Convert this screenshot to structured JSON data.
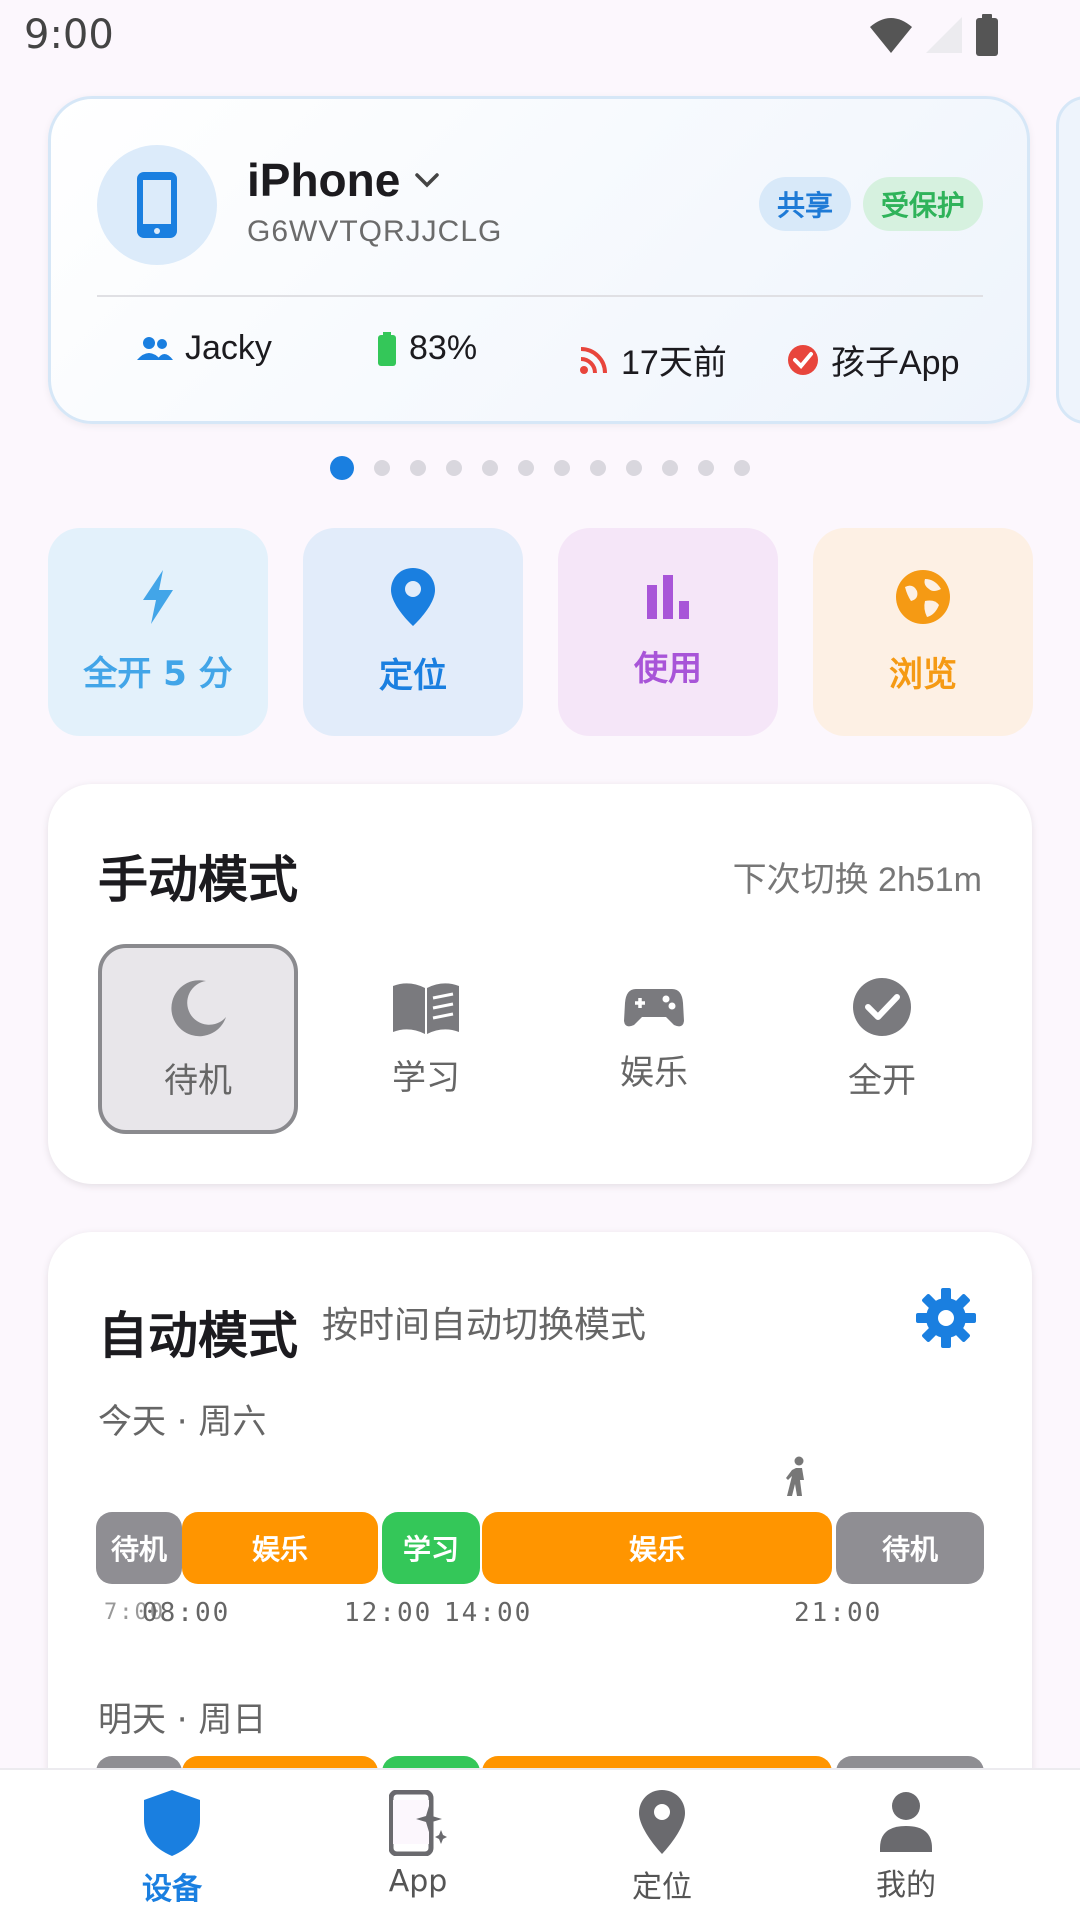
{
  "status_bar": {
    "time": "9:00"
  },
  "device": {
    "name": "iPhone",
    "serial": "G6WVTQRJJCLG",
    "badges": {
      "shared": "共享",
      "protected": "受保护"
    },
    "stats": {
      "user": "Jacky",
      "battery": "83%",
      "last_sync": "17天前",
      "app": "孩子App"
    }
  },
  "pager": {
    "count": 12,
    "active_index": 0
  },
  "quick_actions": [
    {
      "label": "全开 5 分",
      "icon": "bolt-icon",
      "color": "#42a5e8",
      "bg": "#e3f1fb"
    },
    {
      "label": "定位",
      "icon": "location-pin-icon",
      "color": "#1a7fe0",
      "bg": "#e2ecfa"
    },
    {
      "label": "使用",
      "icon": "bar-chart-icon",
      "color": "#a855d8",
      "bg": "#f5e6f8"
    },
    {
      "label": "浏览",
      "icon": "globe-icon",
      "color": "#f59a14",
      "bg": "#fdf0e4"
    }
  ],
  "manual_mode": {
    "title": "手动模式",
    "hint": "下次切换 2h51m",
    "modes": [
      {
        "label": "待机",
        "icon": "moon-icon",
        "selected": true
      },
      {
        "label": "学习",
        "icon": "book-icon",
        "selected": false
      },
      {
        "label": "娱乐",
        "icon": "gamepad-icon",
        "selected": false
      },
      {
        "label": "全开",
        "icon": "check-circle-icon",
        "selected": false
      }
    ]
  },
  "auto_mode": {
    "title": "自动模式",
    "subtitle": "按时间自动切换模式",
    "today": {
      "label": "今天 · 周六",
      "segments": [
        "待机",
        "娱乐",
        "学习",
        "娱乐",
        "待机"
      ],
      "ticks": [
        "7:00",
        "08:00",
        "12:00",
        "14:00",
        "21:00"
      ]
    },
    "tomorrow": {
      "label": "明天 · 周日"
    }
  },
  "bottom_nav": [
    {
      "label": "设备",
      "icon": "shield-icon",
      "active": true
    },
    {
      "label": "App",
      "icon": "app-sparkle-icon",
      "active": false
    },
    {
      "label": "定位",
      "icon": "location-pin-icon",
      "active": false
    },
    {
      "label": "我的",
      "icon": "person-icon",
      "active": false
    }
  ]
}
